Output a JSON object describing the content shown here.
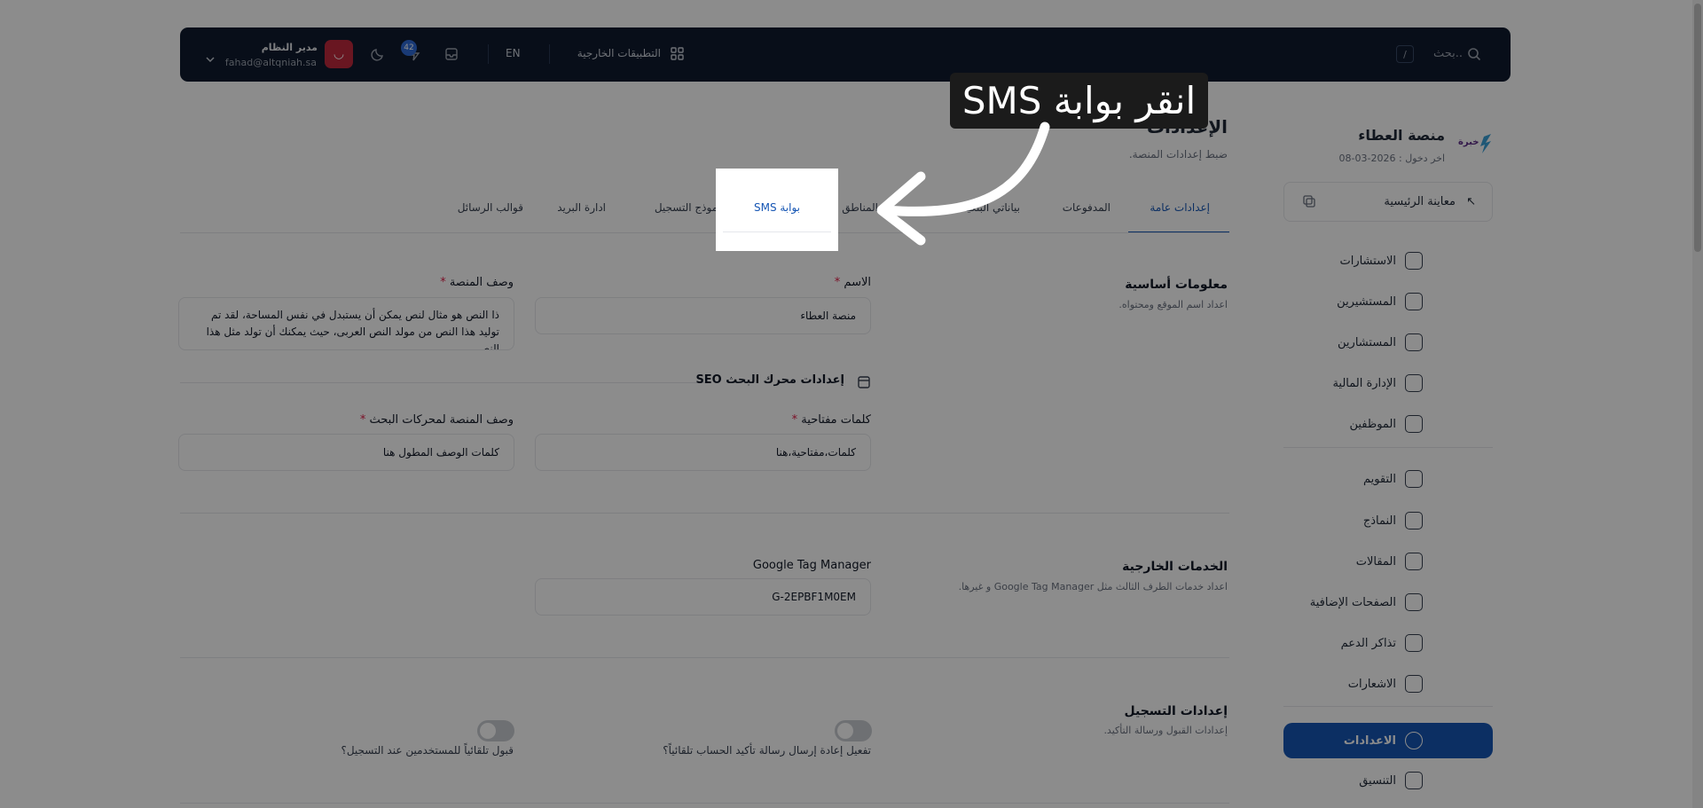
{
  "topbar": {
    "search_placeholder": "بحث..",
    "shortcut": "/",
    "external_apps": "التطبيقات الخارجية",
    "language": "EN",
    "notification_count": "42",
    "user_name": "مدير النظام",
    "user_email": "fahad@altqniah.sa",
    "icons": [
      "search-icon",
      "grid-icon",
      "inbox-icon",
      "bolt-icon",
      "moon-icon",
      "chevron-down-icon"
    ]
  },
  "sidebar": {
    "brand_name": "منصة العطاء",
    "logo_text": "خبرة",
    "last_login": "اخر دخول : 2026-03-08",
    "preview_label": "معاينة الرئيسية",
    "items": [
      {
        "label": "الاستشارات",
        "icon": "layers-icon"
      },
      {
        "label": "المستشيرين",
        "icon": "users-icon"
      },
      {
        "label": "المستشارين",
        "icon": "consultant-icon"
      },
      {
        "label": "الإدارة المالية",
        "icon": "finance-icon"
      },
      {
        "label": "الموظفين",
        "icon": "employee-icon"
      },
      {
        "label": "التقويم",
        "icon": "calendar-icon"
      },
      {
        "label": "النماذج",
        "icon": "form-icon"
      },
      {
        "label": "المقالات",
        "icon": "article-icon"
      },
      {
        "label": "الصفحات الإضافية",
        "icon": "pages-icon"
      },
      {
        "label": "تذاكر الدعم",
        "icon": "ticket-icon"
      },
      {
        "label": "الاشعارات",
        "icon": "send-icon"
      },
      {
        "label": "الاعدادات",
        "icon": "gear-icon"
      },
      {
        "label": "التنسيق",
        "icon": "layout-icon"
      }
    ]
  },
  "page": {
    "title": "الإعدادات",
    "subtitle": "ضبط إعدادات المنصة."
  },
  "tabs": [
    "إعدادات عامة",
    "المدفوعات",
    "بياناتي البنكية",
    "المناطق",
    "بوابة SMS",
    "نموذج التسجيل",
    "ادارة البريد",
    "قوالب الرسائل"
  ],
  "basic_info": {
    "title": "معلومات أساسية",
    "desc": "اعداد اسم الموقع ومحتواه.",
    "name_label": "الاسم",
    "name_value": "منصة العطاء",
    "description_label": "وصف المنصة",
    "description_value": "ذا النص هو مثال لنص يمكن أن يستبدل في نفس المساحة، لقد تم توليد هذا النص من مولد النص العربى، حيث يمكنك أن تولد مثل هذا النص"
  },
  "seo": {
    "title": "إعدادات محرك البحث SEO",
    "keywords_label": "كلمات مفتاحية",
    "keywords_value": "كلمات،مفتاحية،هنا",
    "meta_label": "وصف المنصة لمحركات البحث",
    "meta_value": "كلمات الوصف المطول هنا"
  },
  "external": {
    "title": "الخدمات الخارجية",
    "desc": "اعداد خدمات الطرف الثالث مثل Google Tag Manager و غيرها.",
    "gtm_label": "Google Tag Manager",
    "gtm_value": "G-2EPBF1M0EM"
  },
  "registration": {
    "title": "إعدادات التسجيل",
    "desc": "إعدادات القبول ورسالة التأكيد.",
    "resend_label": "تفعيل إعادة إرسال رسالة تأكيد الحساب تلقائياً؟",
    "auto_accept_label": "قبول تلقائياً للمستخدمين عند التسجيل؟"
  },
  "required_mark": "*",
  "overlay": {
    "callout_text": "انقر بوابة SMS",
    "highlighted_tab": "بوابة SMS"
  }
}
